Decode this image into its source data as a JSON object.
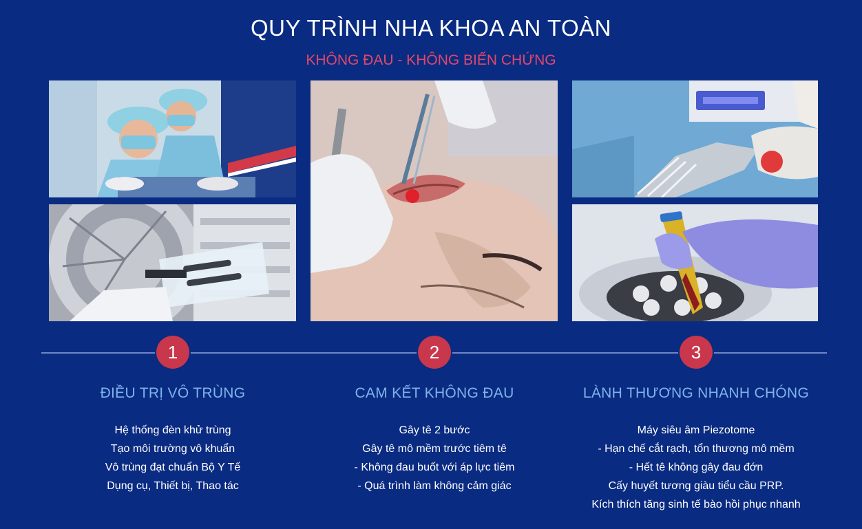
{
  "header": {
    "title": "QUY TRÌNH NHA KHOA AN TOÀN",
    "subtitle": "KHÔNG ĐAU - KHÔNG BIẾN CHỨNG"
  },
  "colors": {
    "background": "#0a2b82",
    "accent_red": "#c8374c",
    "subtitle_pink": "#e0486a",
    "column_title_blue": "#7fb3ea"
  },
  "steps": [
    {
      "number": "1",
      "title": "ĐIỀU TRỊ VÔ TRÙNG",
      "lines": [
        "Hệ thống đèn khử trùng",
        "Tạo môi trường vô khuẩn",
        "Vô trùng đạt chuẩn Bộ Y Tế",
        "Dụng cụ, Thiết bị, Thao tác"
      ]
    },
    {
      "number": "2",
      "title": "CAM KẾT KHÔNG ĐAU",
      "lines": [
        "Gây tê 2 bước",
        "Gây tê mô mềm trước tiêm tê",
        "- Không đau buốt với áp lực tiêm",
        "- Quá trình làm không cảm giác"
      ]
    },
    {
      "number": "3",
      "title": "LÀNH THƯƠNG NHANH CHÓNG",
      "lines": [
        "Máy siêu âm Piezotome",
        "- Hạn chế cắt rạch, tổn thương mô mềm",
        "- Hết tê không gây đau đớn",
        "Cấy huyết tương giàu tiểu cầu PRP.",
        "Kích thích tăng sinh tế bào hồi phục nhanh"
      ]
    }
  ]
}
